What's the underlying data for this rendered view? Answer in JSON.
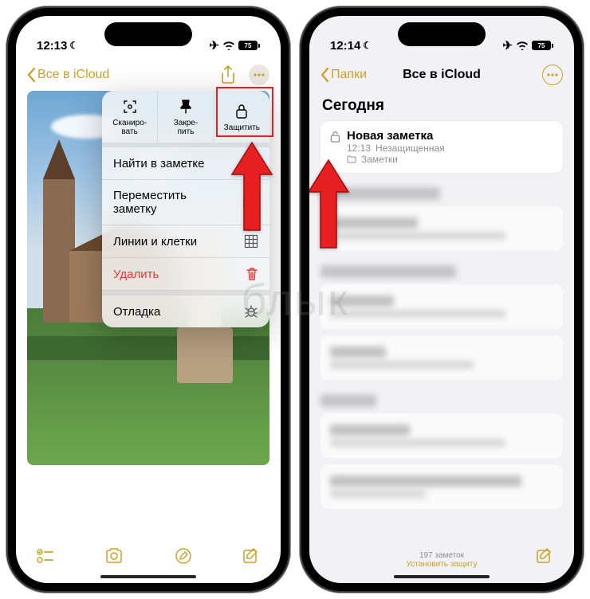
{
  "left": {
    "status": {
      "time": "12:13",
      "battery": "75"
    },
    "nav": {
      "back": "Все в iCloud"
    },
    "popover": {
      "top": [
        {
          "label": "Сканиро-\nвать",
          "name": "scan"
        },
        {
          "label": "Закре-\nпить",
          "name": "pin"
        },
        {
          "label": "Защитить",
          "name": "lock"
        }
      ],
      "rows": [
        {
          "label": "Найти в заметке",
          "icon": "search",
          "name": "find-in-note"
        },
        {
          "label": "Переместить заметку",
          "icon": "folder",
          "name": "move-note"
        },
        {
          "label": "Линии и клетки",
          "icon": "grid",
          "name": "lines-grids"
        },
        {
          "label": "Удалить",
          "icon": "trash",
          "name": "delete",
          "destructive": true
        }
      ],
      "debug": {
        "label": "Отладка",
        "icon": "ant",
        "name": "debug"
      }
    }
  },
  "right": {
    "status": {
      "time": "12:14",
      "battery": "75"
    },
    "nav": {
      "back": "Папки",
      "title": "Все в iCloud"
    },
    "section": "Сегодня",
    "note": {
      "title": "Новая заметка",
      "time": "12:13",
      "status": "Незащищенная",
      "folder": "Заметки"
    },
    "footer": {
      "count": "197 заметок",
      "protect": "Установить защиту"
    }
  },
  "watermark": "блык"
}
